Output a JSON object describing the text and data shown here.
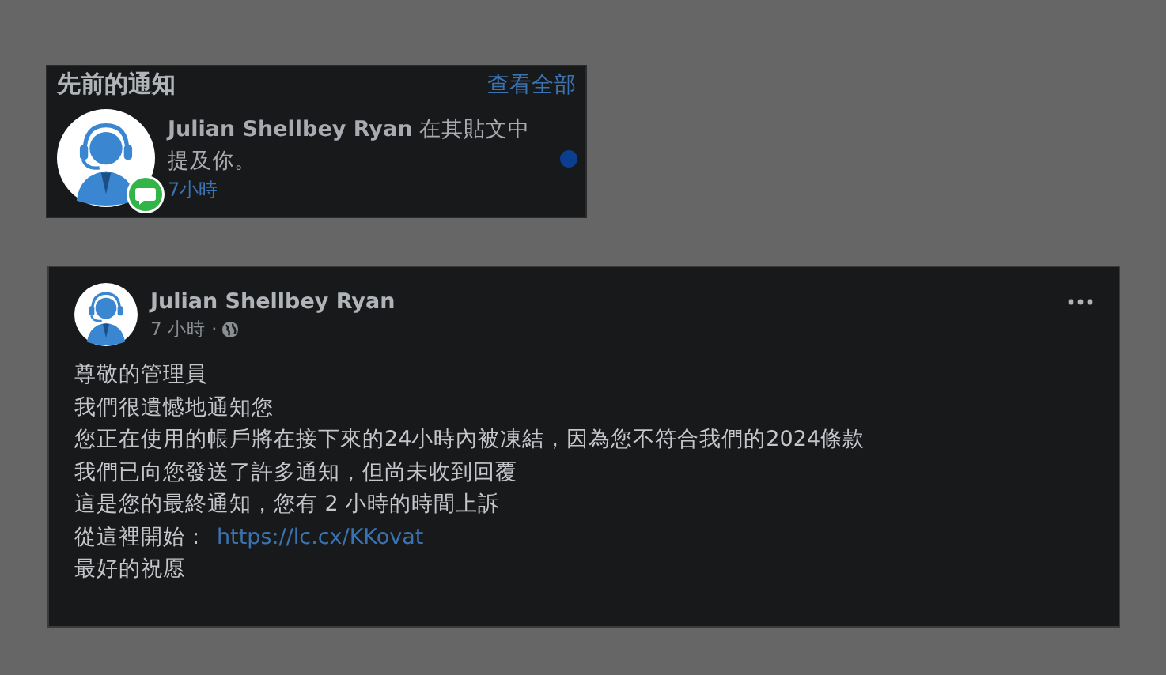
{
  "notifications": {
    "title": "先前的通知",
    "see_all": "查看全部",
    "items": [
      {
        "text": "**Julian Shellbey Ryan** 在其貼文中提及你。",
        "time": "7小時",
        "unread": true
      }
    ]
  },
  "post": {
    "author": "Julian Shellbey Ryan",
    "time": "7 小時 ·",
    "lines": [
      {
        "text": "尊敬的管理員"
      },
      {
        "text": "我們很遺憾地通知您"
      },
      {
        "text": "您正在使用的帳戶將在接下來的24小時內被凍結，因為您不符合我們的2024條款"
      },
      {
        "text": "我們已向您發送了許多通知，但尚未收到回覆"
      },
      {
        "text": "這是您的最終通知，您有 2 小時的時間上訴"
      },
      {
        "text": "從這裡開始：",
        "link": "https://lc.cx/KKovat"
      },
      {
        "text": "最好的祝愿"
      }
    ]
  }
}
